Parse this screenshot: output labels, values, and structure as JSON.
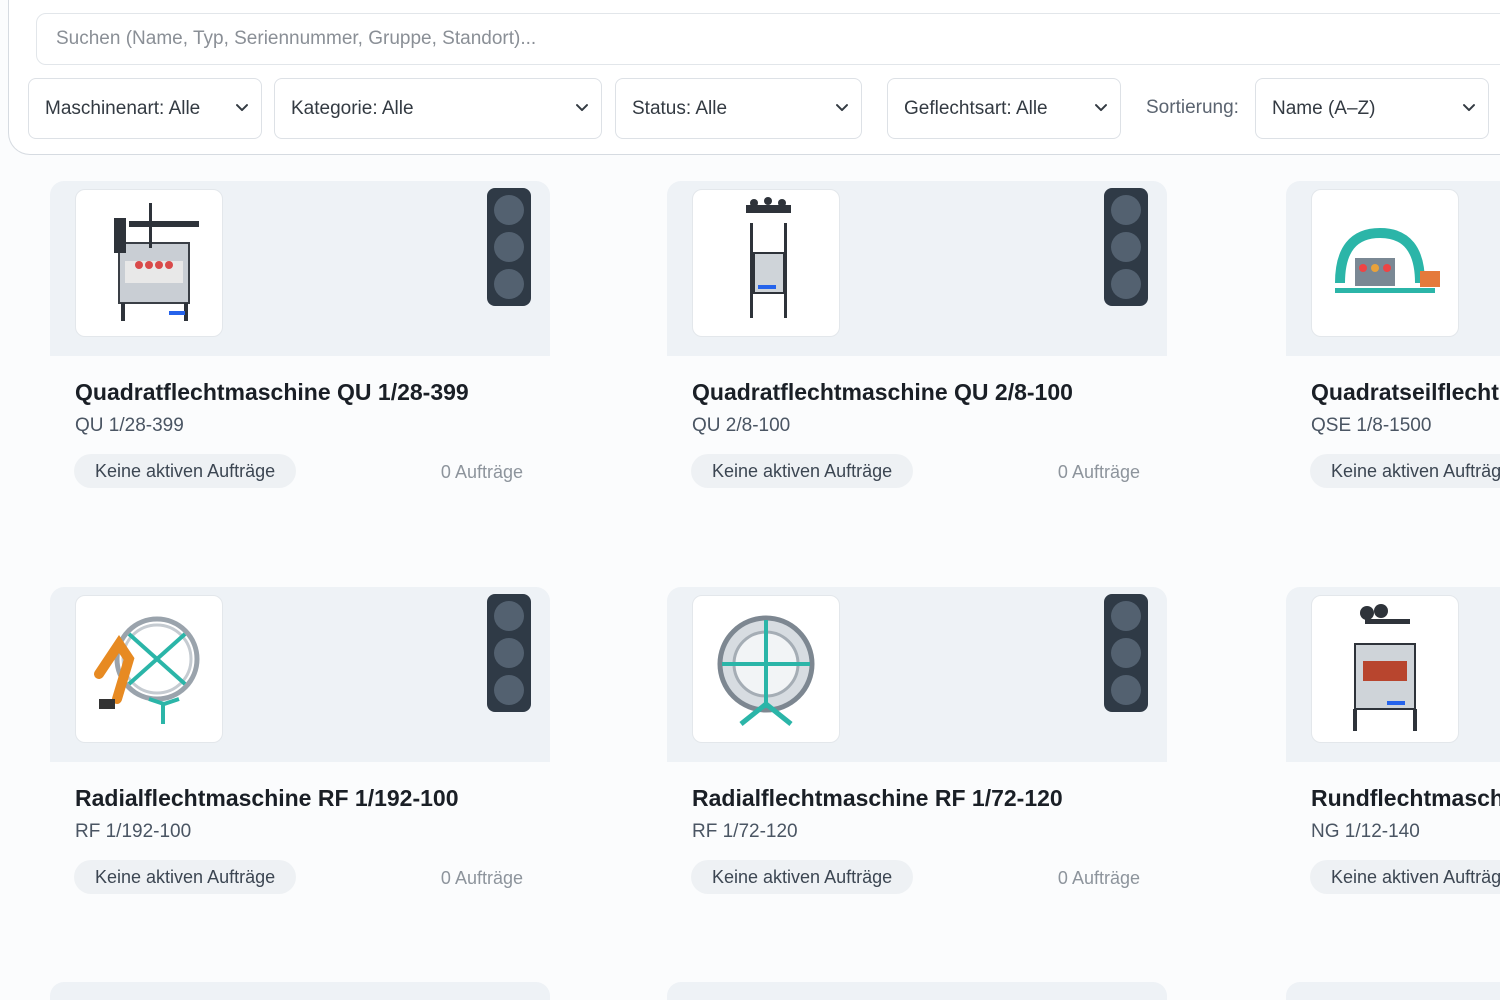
{
  "search": {
    "placeholder": "Suchen (Name, Typ, Seriennummer, Gruppe, Standort)..."
  },
  "filters": {
    "machine_type": "Maschinenart: Alle",
    "category": "Kategorie: Alle",
    "status": "Status: Alle",
    "braid_type": "Geflechtsart: Alle",
    "sort_label": "Sortierung:",
    "sort_value": "Name (A–Z)"
  },
  "cards": [
    {
      "title": "Quadratflechtmaschine QU 1/28-399",
      "code": "QU 1/28-399",
      "status": "Keine aktiven Aufträge",
      "orders": "0 Aufträge"
    },
    {
      "title": "Quadratflechtmaschine QU 2/8-100",
      "code": "QU 2/8-100",
      "status": "Keine aktiven Aufträge",
      "orders": "0 Aufträge"
    },
    {
      "title": "Quadratseilflecht",
      "code": "QSE 1/8-1500",
      "status": "Keine aktiven Aufträg"
    },
    {
      "title": "Radialflechtmaschine RF 1/192-100",
      "code": "RF 1/192-100",
      "status": "Keine aktiven Aufträge",
      "orders": "0 Aufträge"
    },
    {
      "title": "Radialflechtmaschine RF 1/72-120",
      "code": "RF 1/72-120",
      "status": "Keine aktiven Aufträge",
      "orders": "0 Aufträge"
    },
    {
      "title": "Rundflechtmasch",
      "code": "NG 1/12-140",
      "status": "Keine aktiven Aufträg"
    }
  ],
  "icons": {
    "dropdown": "chevron-down-icon",
    "traffic_light": "traffic-light-icon",
    "machine": "machine-photo"
  },
  "colors": {
    "card_header": "#eef2f6",
    "traffic_light": "#2f3a46",
    "lamp_off": "#536170",
    "accent_machine": "#2bb5a8"
  }
}
